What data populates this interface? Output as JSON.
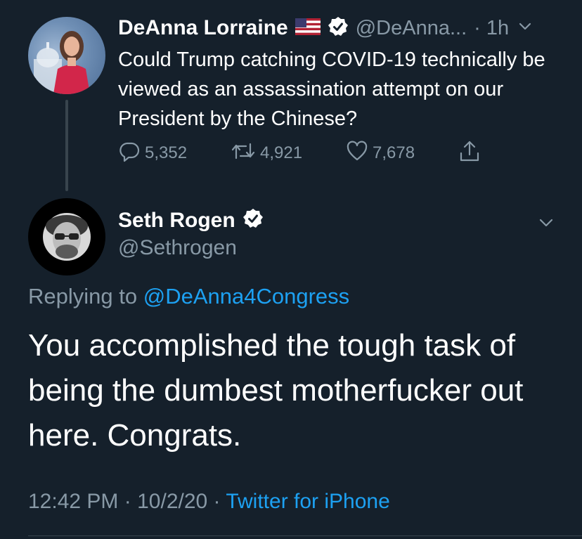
{
  "parent_tweet": {
    "author_name": "DeAnna Lorraine",
    "flag_icon": "us-flag-icon",
    "verified_icon": "verified-badge-icon",
    "handle": "@DeAnna...",
    "time": "· 1h",
    "text": "Could Trump catching COVID-19 technically be viewed as an assassination attempt on our President by the Chinese?",
    "replies": "5,352",
    "retweets": "4,921",
    "likes": "7,678"
  },
  "reply_tweet": {
    "author_name": "Seth Rogen",
    "verified_icon": "verified-badge-icon",
    "handle": "@Sethrogen",
    "replying_prefix": "Replying to",
    "replying_to": "@DeAnna4Congress",
    "text": "You accomplished the tough task of being the dumbest motherfucker out here. Congrats.",
    "time": "12:42 PM",
    "date": "10/2/20",
    "separator": "·",
    "source": "Twitter for iPhone"
  },
  "colors": {
    "background": "#15202b",
    "text": "#ffffff",
    "secondary": "#8899a6",
    "accent": "#1da1f2"
  }
}
